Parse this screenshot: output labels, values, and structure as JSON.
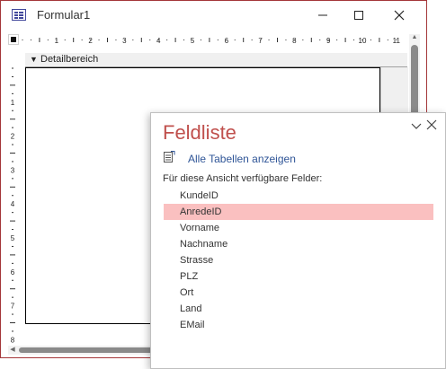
{
  "window": {
    "title": "Formular1"
  },
  "ruler": {
    "h_numbers": [
      "1",
      "2",
      "3",
      "4",
      "5",
      "6",
      "7",
      "8",
      "9",
      "10",
      "11"
    ],
    "v_numbers": [
      "1",
      "2",
      "3",
      "4",
      "5",
      "6",
      "7",
      "8"
    ]
  },
  "section": {
    "label": "Detailbereich"
  },
  "field_list": {
    "title": "Feldliste",
    "link": "Alle Tabellen anzeigen",
    "subheading": "Für diese Ansicht verfügbare Felder:",
    "fields": [
      "KundeID",
      "AnredeID",
      "Vorname",
      "Nachname",
      "Strasse",
      "PLZ",
      "Ort",
      "Land",
      "EMail"
    ],
    "selected_index": 1
  },
  "colors": {
    "window_border": "#a4373a",
    "pane_title": "#c0504d",
    "link": "#2f5597",
    "selected_field": "#fac0c0"
  }
}
